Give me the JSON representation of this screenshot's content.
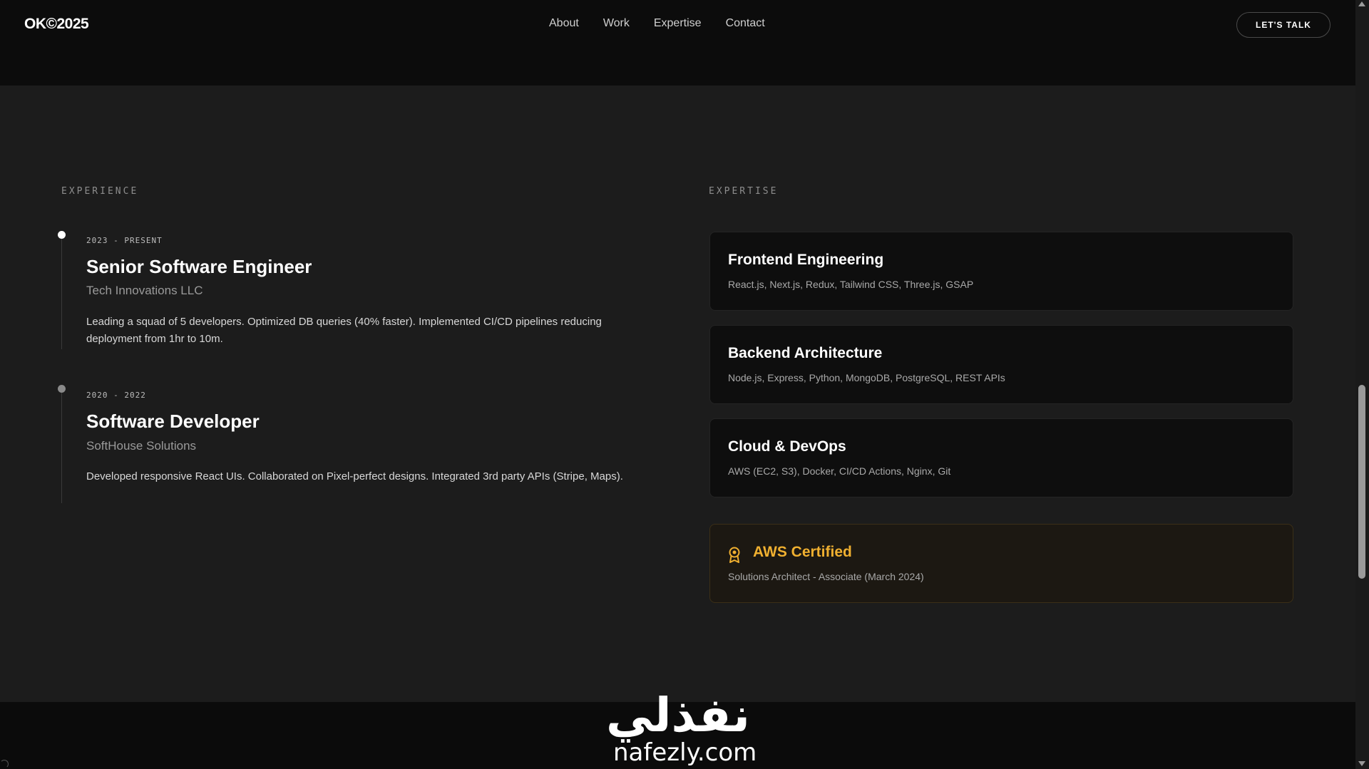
{
  "header": {
    "logo": "OK©2025",
    "nav": [
      "About",
      "Work",
      "Expertise",
      "Contact"
    ],
    "cta": "LET'S TALK"
  },
  "experience": {
    "label": "EXPERIENCE",
    "items": [
      {
        "period": "2023 - PRESENT",
        "role": "Senior Software Engineer",
        "company": "Tech Innovations LLC",
        "description": "Leading a squad of 5 developers. Optimized DB queries (40% faster). Implemented CI/CD pipelines reducing deployment from 1hr to 10m."
      },
      {
        "period": "2020 - 2022",
        "role": "Software Developer",
        "company": "SoftHouse Solutions",
        "description": "Developed responsive React UIs. Collaborated on Pixel-perfect designs. Integrated 3rd party APIs (Stripe, Maps)."
      }
    ]
  },
  "expertise": {
    "label": "EXPERTISE",
    "cards": [
      {
        "title": "Frontend Engineering",
        "skills": "React.js, Next.js, Redux, Tailwind CSS, Three.js, GSAP"
      },
      {
        "title": "Backend Architecture",
        "skills": "Node.js, Express, Python, MongoDB, PostgreSQL, REST APIs"
      },
      {
        "title": "Cloud & DevOps",
        "skills": "AWS (EC2, S3), Docker, CI/CD Actions, Nginx, Git"
      }
    ],
    "certification": {
      "icon": "award-icon",
      "title": "AWS Certified",
      "detail": "Solutions Architect - Associate (March 2024)"
    }
  },
  "watermark": {
    "arabic": "نفذلي",
    "latin": "nafezly.com"
  },
  "colors": {
    "background": "#1c1c1c",
    "header": "#0c0c0c",
    "card": "#0e0e0e",
    "accent": "#f0b030"
  }
}
